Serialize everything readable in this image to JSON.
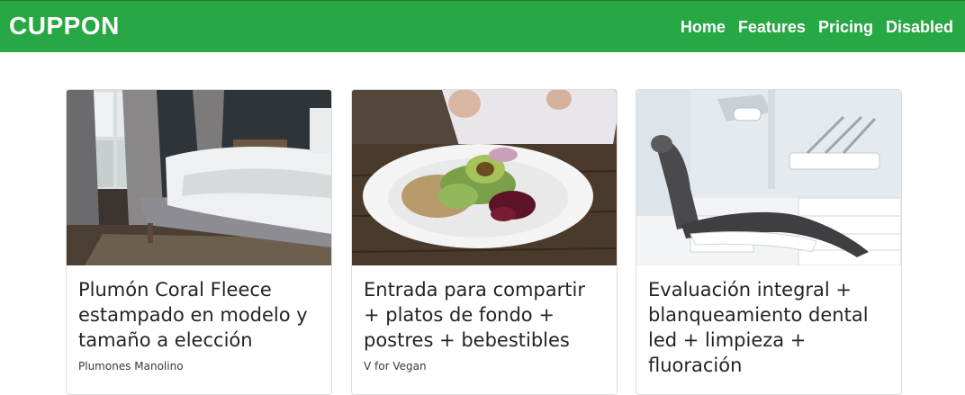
{
  "navbar": {
    "brand": "CUPPON",
    "links": [
      "Home",
      "Features",
      "Pricing",
      "Disabled"
    ]
  },
  "cards": [
    {
      "title": "Plumón Coral Fleece estampado en modelo y tamaño a elección",
      "subtitle": "Plumones Manolino",
      "image": "bedroom-photo"
    },
    {
      "title": "Entrada para compartir + platos de fondo + postres + bebestibles",
      "subtitle": "V for Vegan",
      "image": "salad-plate-photo"
    },
    {
      "title": "Evaluación integral + blanqueamiento dental led + limpieza + fluoración",
      "subtitle": "",
      "image": "dental-chair-photo"
    }
  ],
  "colors": {
    "navbar": "#28a745",
    "nav_text": "#ffffff"
  }
}
